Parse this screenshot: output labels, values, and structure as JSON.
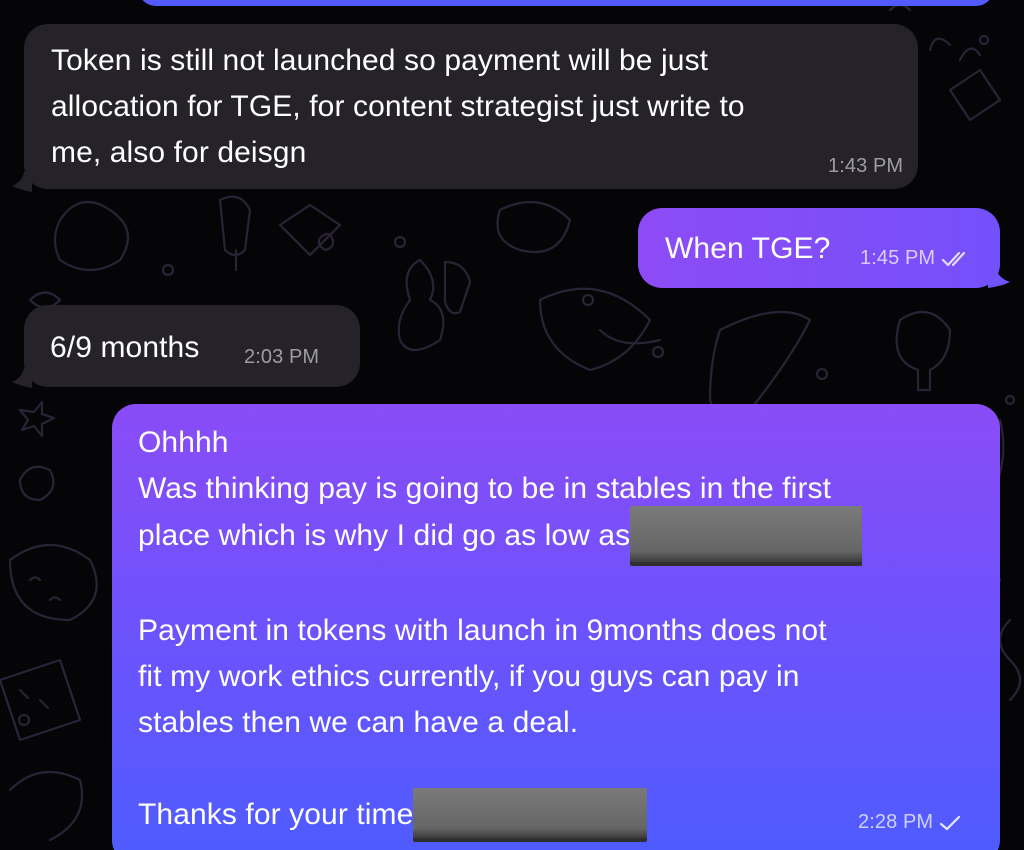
{
  "messages": [
    {
      "id": "m1",
      "direction": "incoming",
      "lines": [
        "Token is still not launched so payment will be just",
        "allocation for TGE, for content strategist just write to",
        "me, also for deisgn"
      ],
      "time": "1:43 PM"
    },
    {
      "id": "m2",
      "direction": "outgoing",
      "text": "When TGE?",
      "time": "1:45 PM",
      "status": "read"
    },
    {
      "id": "m3",
      "direction": "incoming",
      "text": "6/9 months",
      "time": "2:03 PM"
    },
    {
      "id": "m4",
      "direction": "outgoing",
      "lines": [
        "Ohhhh",
        "Was thinking pay is going to be in stables in the first",
        "place which is why I did go as low as",
        "",
        "Payment in tokens with launch in 9months does not",
        "fit my work ethics currently, if you guys can pay in",
        "stables then we can have a deal.",
        "",
        "Thanks for your time"
      ],
      "time": "2:28 PM",
      "status": "sent"
    }
  ],
  "colors": {
    "incoming_bubble": "#252229",
    "outgoing_gradient_top": "#8a4cf7",
    "outgoing_gradient_bottom": "#4d5cff",
    "background": "#050507"
  }
}
